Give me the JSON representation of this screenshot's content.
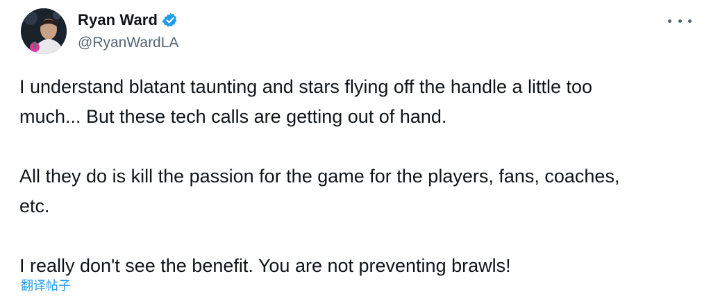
{
  "tweet": {
    "author": {
      "display_name": "Ryan Ward",
      "handle": "@RyanWardLA",
      "verified": true,
      "avatar_icon": "profile-avatar"
    },
    "more_icon": "more-options-icon",
    "paragraphs": [
      "I understand blatant taunting and stars flying off the handle a little too\nmuch... But these tech calls are getting out of hand.",
      "All they do is kill the passion for the game for the players, fans, coaches,\netc.",
      "I really don't see the benefit. You are not preventing brawls!"
    ],
    "translate_label": "翻译帖子"
  },
  "colors": {
    "text": "#0f1419",
    "secondary": "#536471",
    "accent": "#1d9bf0"
  }
}
